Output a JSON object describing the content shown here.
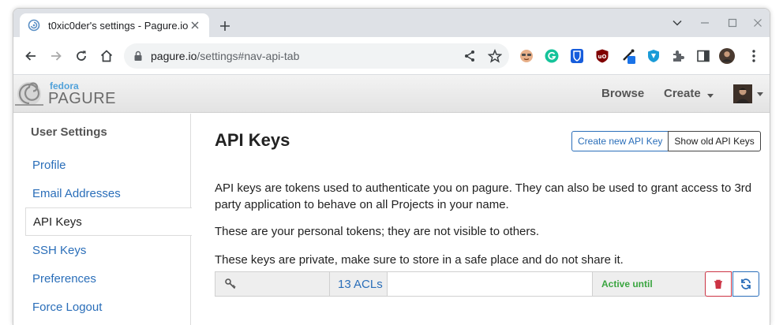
{
  "browser": {
    "tab_title": "t0xic0der's settings - Pagure.io",
    "url_host": "pagure.io",
    "url_path": "/settings#nav-api-tab"
  },
  "icons": {
    "favicon": "pagure-favicon-icon",
    "tab_close": "close-icon",
    "new_tab": "plus-icon",
    "back": "arrow-left-icon",
    "forward": "arrow-right-icon",
    "reload": "reload-icon",
    "home": "home-icon",
    "lock": "lock-icon",
    "share": "share-icon",
    "bookmark": "star-icon",
    "extensions": [
      "extension-face-icon",
      "grammarly-icon",
      "bitwarden-icon",
      "ublock-icon",
      "eyedropper-icon",
      "shield-icon",
      "puzzle-icon",
      "side-panel-icon"
    ],
    "menu": "kebab-menu-icon",
    "key": "key-icon",
    "trash": "trash-icon",
    "refresh": "refresh-icon"
  },
  "header": {
    "logo_fedora": "fedora",
    "logo_pagure": "PAGURE",
    "browse": "Browse",
    "create": "Create"
  },
  "sidebar": {
    "heading": "User Settings",
    "items": [
      {
        "label": "Profile"
      },
      {
        "label": "Email Addresses"
      },
      {
        "label": "API Keys",
        "active": true
      },
      {
        "label": "SSH Keys"
      },
      {
        "label": "Preferences"
      },
      {
        "label": "Force Logout"
      }
    ]
  },
  "main": {
    "title": "API Keys",
    "create_button": "Create new API Key",
    "old_button": "Show old API Keys",
    "para1": "API keys are tokens used to authenticate you on pagure. They can also be used to grant access to 3rd party application to behave on all Projects in your name.",
    "para2": "These are your personal tokens; they are not visible to others.",
    "para3": "These keys are private, make sure to store in a safe place and do not share it.",
    "key_row": {
      "acls": "13 ACLs",
      "token_value": "",
      "status": "Active until"
    }
  },
  "colors": {
    "link": "#2a6eb9",
    "active_green": "#3aa540",
    "danger": "#cc3344",
    "fedora_blue": "#51a2da"
  }
}
